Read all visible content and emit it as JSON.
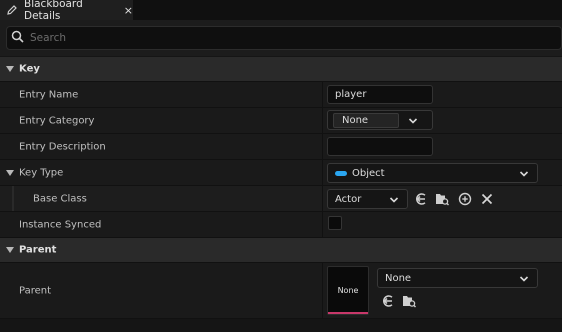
{
  "tab": {
    "title": "Blackboard Details",
    "close": "×",
    "icon": "pencil-icon"
  },
  "search": {
    "placeholder": "Search",
    "value": ""
  },
  "categories": {
    "key": "Key",
    "parent": "Parent"
  },
  "properties": {
    "entry_name": {
      "label": "Entry Name",
      "value": "player"
    },
    "entry_category": {
      "label": "Entry Category",
      "value": "None"
    },
    "entry_description": {
      "label": "Entry Description",
      "value": ""
    },
    "key_type": {
      "label": "Key Type",
      "value": "Object",
      "pill_color": "#2aa6f1"
    },
    "base_class": {
      "label": "Base Class",
      "value": "Actor"
    },
    "instance_synced": {
      "label": "Instance Synced",
      "checked": false
    },
    "parent": {
      "label": "Parent",
      "thumbnail": "None",
      "value": "None",
      "thumb_accent": "#c8386a"
    }
  },
  "icons": [
    "pencil-icon",
    "search-icon",
    "chevron-down-icon",
    "use-selected-icon",
    "browse-folder-icon",
    "add-icon",
    "clear-icon"
  ]
}
